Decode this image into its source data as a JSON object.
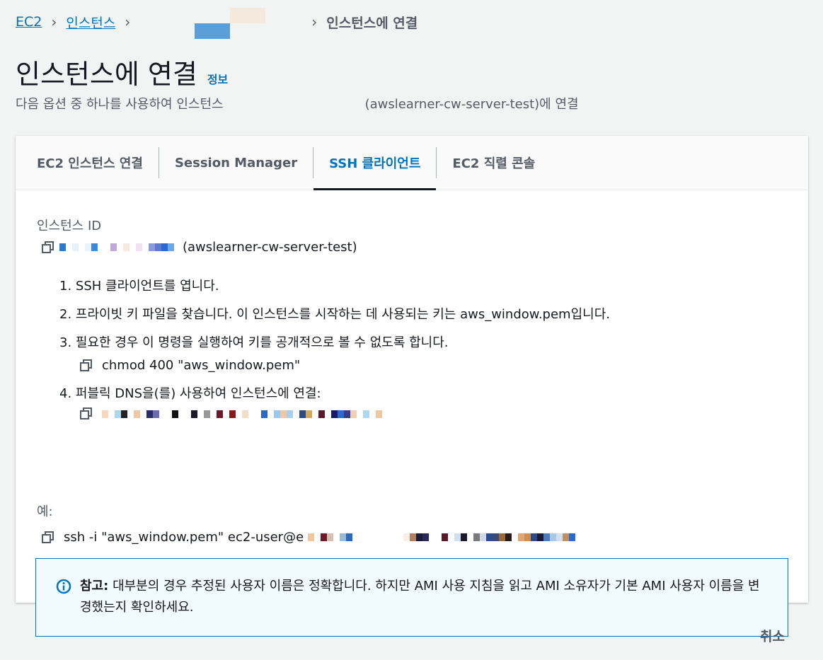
{
  "breadcrumb": {
    "root": "EC2",
    "section": "인스턴스",
    "current": "인스턴스에 연결"
  },
  "header": {
    "title": "인스턴스에 연결",
    "info": "정보",
    "subtitle_start": "다음 옵션 중 하나를 사용하여 인스턴스",
    "subtitle_end": "(awslearner-cw-server-test)에 연결"
  },
  "tabs": [
    {
      "label": "EC2 인스턴스 연결"
    },
    {
      "label": "Session Manager"
    },
    {
      "label": "SSH 클라이언트",
      "active": true
    },
    {
      "label": "EC2 직렬 콘솔"
    }
  ],
  "instance": {
    "label": "인스턴스 ID",
    "name": "(awslearner-cw-server-test)"
  },
  "steps": [
    "1. SSH 클라이언트를 엽니다.",
    "2. 프라이빗 키 파일을 찾습니다. 이 인스턴스를 시작하는 데 사용되는 키는 aws_window.pem입니다.",
    "3. 필요한 경우 이 명령을 실행하여 키를 공개적으로 볼 수 없도록 합니다.",
    "4. 퍼블릭 DNS을(를) 사용하여 인스턴스에 연결:"
  ],
  "chmod_command": "chmod 400 \"aws_window.pem\"",
  "example": {
    "label": "예:",
    "command": "ssh -i \"aws_window.pem\" ec2-user@e"
  },
  "note": {
    "title": "참고:",
    "text": "대부분의 경우 추정된 사용자 이름은 정확합니다. 하지만 AMI 사용 지침을 읽고 AMI 소유자가 기본 AMI 사용자 이름을 변경했는지 확인하세요."
  },
  "actions": {
    "cancel": "취소"
  },
  "colors": {
    "link": "#0073bb",
    "text": "#16191f",
    "muted": "#545b64",
    "alert_bg": "#f1faff"
  }
}
